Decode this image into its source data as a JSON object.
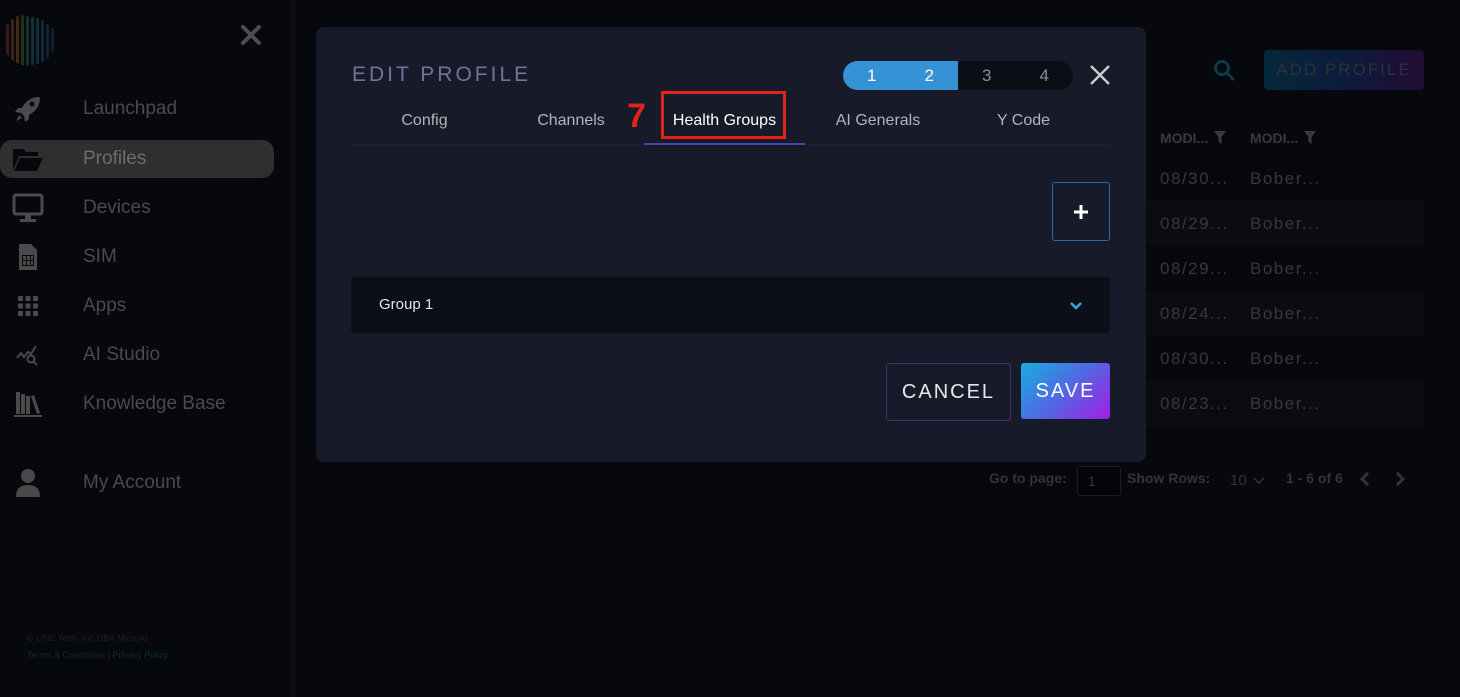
{
  "sidebar": {
    "close_icon": "close-icon",
    "items": [
      {
        "label": "Launchpad",
        "icon": "rocket-icon",
        "active": false
      },
      {
        "label": "Profiles",
        "icon": "folder-open-icon",
        "active": true
      },
      {
        "label": "Devices",
        "icon": "monitor-icon",
        "active": false
      },
      {
        "label": "SIM",
        "icon": "sim-card-icon",
        "active": false
      },
      {
        "label": "Apps",
        "icon": "grid-icon",
        "active": false
      },
      {
        "label": "AI Studio",
        "icon": "chart-search-icon",
        "active": false
      },
      {
        "label": "Knowledge Base",
        "icon": "books-icon",
        "active": false
      }
    ],
    "account": {
      "label": "My Account",
      "icon": "user-icon"
    },
    "footer": {
      "copyright": "© ONE Tech, Inc DBA MicroAI",
      "terms": "Terms & Conditions",
      "separator": "|",
      "privacy": "Privacy Policy"
    }
  },
  "background": {
    "add_profile_label": "ADD PROFILE",
    "columns": [
      "MODI...",
      "MODI..."
    ],
    "rows": [
      {
        "modified_date": "08/30...",
        "modified_by": "Bober..."
      },
      {
        "modified_date": "08/29...",
        "modified_by": "Bober..."
      },
      {
        "modified_date": "08/29...",
        "modified_by": "Bober..."
      },
      {
        "modified_date": "08/24...",
        "modified_by": "Bober..."
      },
      {
        "modified_date": "08/30...",
        "modified_by": "Bober..."
      },
      {
        "modified_date": "08/23...",
        "modified_by": "Bober..."
      }
    ],
    "pager": {
      "go_to_page_label": "Go to page:",
      "page_value": "1",
      "show_rows_label": "Show Rows:",
      "rows_value": "10",
      "range_text": "1 - 6 of 6"
    }
  },
  "modal": {
    "title": "EDIT PROFILE",
    "steps": [
      {
        "label": "1",
        "done": true
      },
      {
        "label": "2",
        "done": true
      },
      {
        "label": "3",
        "done": false
      },
      {
        "label": "4",
        "done": false
      }
    ],
    "tabs": [
      {
        "label": "Config",
        "active": false
      },
      {
        "label": "Channels",
        "active": false
      },
      {
        "label": "Health Groups",
        "active": true
      },
      {
        "label": "AI Generals",
        "active": false
      },
      {
        "label": "Y Code",
        "active": false
      }
    ],
    "annotation_number": "7",
    "add_button_label": "+",
    "groups": [
      {
        "label": "Group 1",
        "expanded": false
      }
    ],
    "cancel_label": "CANCEL",
    "save_label": "SAVE"
  },
  "colors": {
    "accent_blue": "#3592d4",
    "tab_underline": "#3e47b4",
    "annotation_red": "#e2231a",
    "modal_bg": "#171a29"
  }
}
